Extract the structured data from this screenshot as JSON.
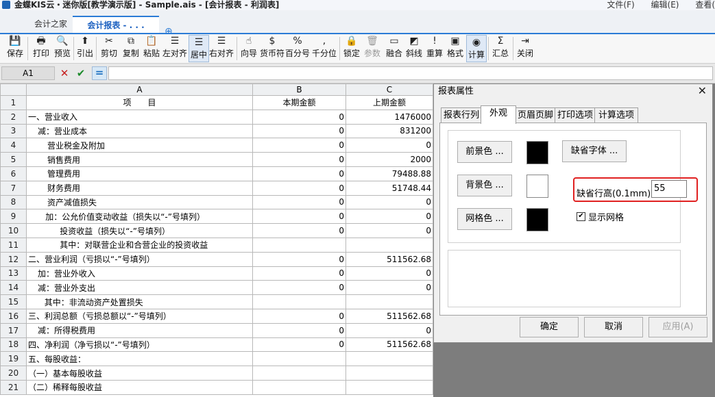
{
  "app": {
    "title": "金蝶KIS云・迷你版[教学演示版] - Sample.ais - [会计报表 - 利润表]",
    "menu": [
      "文件(F)",
      "编辑(E)",
      "查看("
    ]
  },
  "tabs": {
    "home": "会计之家",
    "report": "会计报表 - . . .",
    "add": "⊕"
  },
  "toolbar": [
    {
      "label": "保存",
      "icon": "💾"
    },
    {
      "label": "打印",
      "icon": "🖶"
    },
    {
      "label": "预览",
      "icon": "🔍"
    },
    {
      "label": "引出",
      "icon": "⬆"
    },
    {
      "label": "剪切",
      "icon": "✂"
    },
    {
      "label": "复制",
      "icon": "⧉"
    },
    {
      "label": "粘贴",
      "icon": "📋"
    },
    {
      "label": "左对齐",
      "icon": "☰"
    },
    {
      "label": "居中",
      "icon": "☰"
    },
    {
      "label": "右对齐",
      "icon": "☰"
    },
    {
      "label": "向导",
      "icon": "☝"
    },
    {
      "label": "货币符",
      "icon": "$"
    },
    {
      "label": "百分号",
      "icon": "%"
    },
    {
      "label": "千分位",
      "icon": ","
    },
    {
      "label": "锁定",
      "icon": "🔒"
    },
    {
      "label": "参数",
      "icon": "🗑"
    },
    {
      "label": "融合",
      "icon": "▭"
    },
    {
      "label": "斜线",
      "icon": "◩"
    },
    {
      "label": "重算",
      "icon": "!"
    },
    {
      "label": "格式",
      "icon": "▣"
    },
    {
      "label": "计算",
      "icon": "◉"
    },
    {
      "label": "汇总",
      "icon": "Σ"
    },
    {
      "label": "关闭",
      "icon": "⇥"
    }
  ],
  "formula_bar": {
    "cell": "A1",
    "cancel": "✕",
    "ok": "✔",
    "equals": "="
  },
  "sheet": {
    "columns": [
      "A",
      "B",
      "C"
    ],
    "header_row": {
      "a": "项　　目",
      "b": "本期金额",
      "c": "上期金额"
    },
    "rows": [
      {
        "n": "2",
        "a": "一、营业收入",
        "b": "0",
        "c": "1476000",
        "ind": 0
      },
      {
        "n": "3",
        "a": "减：营业成本",
        "b": "0",
        "c": "831200",
        "ind": 1
      },
      {
        "n": "4",
        "a": "营业税金及附加",
        "b": "0",
        "c": "0",
        "ind": 2
      },
      {
        "n": "5",
        "a": "销售费用",
        "b": "0",
        "c": "2000",
        "ind": 2
      },
      {
        "n": "6",
        "a": "管理费用",
        "b": "0",
        "c": "79488.88",
        "ind": 2
      },
      {
        "n": "7",
        "a": "财务费用",
        "b": "0",
        "c": "51748.44",
        "ind": 2
      },
      {
        "n": "8",
        "a": "资产减值损失",
        "b": "0",
        "c": "0",
        "ind": 2
      },
      {
        "n": "9",
        "a": "加：公允价值变动收益（损失以“-”号填列）",
        "b": "0",
        "c": "0",
        "ind": 1.8
      },
      {
        "n": "10",
        "a": "投资收益（损失以“-”号填列）",
        "b": "0",
        "c": "0",
        "ind": 3.3
      },
      {
        "n": "11",
        "a": "其中：对联营企业和合营企业的投资收益",
        "b": "",
        "c": "",
        "ind": 3.3
      },
      {
        "n": "12",
        "a": "二、营业利润（亏损以“-”号填列）",
        "b": "0",
        "c": "511562.68",
        "ind": 0
      },
      {
        "n": "13",
        "a": "加：营业外收入",
        "b": "0",
        "c": "0",
        "ind": 1
      },
      {
        "n": "14",
        "a": "减：营业外支出",
        "b": "0",
        "c": "0",
        "ind": 1
      },
      {
        "n": "15",
        "a": "其中：非流动资产处置损失",
        "b": "",
        "c": "",
        "ind": 1.7
      },
      {
        "n": "16",
        "a": "三、利润总额（亏损总额以“-”号填列）",
        "b": "0",
        "c": "511562.68",
        "ind": 0
      },
      {
        "n": "17",
        "a": "减：所得税费用",
        "b": "0",
        "c": "0",
        "ind": 1
      },
      {
        "n": "18",
        "a": "四、净利润（净亏损以“-”号填列）",
        "b": "0",
        "c": "511562.68",
        "ind": 0
      },
      {
        "n": "19",
        "a": "五、每股收益：",
        "b": "",
        "c": "",
        "ind": 0
      },
      {
        "n": "20",
        "a": "（一）基本每股收益",
        "b": "",
        "c": "",
        "ind": 0
      },
      {
        "n": "21",
        "a": "（二）稀释每股收益",
        "b": "",
        "c": "",
        "ind": 0
      }
    ]
  },
  "dialog": {
    "title": "报表属性",
    "close": "✕",
    "tabs": [
      "报表行列",
      "外观",
      "页眉页脚",
      "打印选项",
      "计算选项"
    ],
    "active_tab": "外观",
    "fg_button": "前景色 ...",
    "bg_button": "背景色 ...",
    "grid_button": "网格色 ...",
    "font_button": "缺省字体 ...",
    "row_height_label": "缺省行高(0.1mm)",
    "row_height_value": "55",
    "show_grid_label": "显示网格",
    "show_grid_checked": "✔",
    "ok": "确定",
    "cancel": "取消",
    "apply": "应用(A)",
    "colors": {
      "fg": "#000000",
      "bg": "#ffffff",
      "grid": "#000000",
      "highlight": "#e02020"
    }
  }
}
